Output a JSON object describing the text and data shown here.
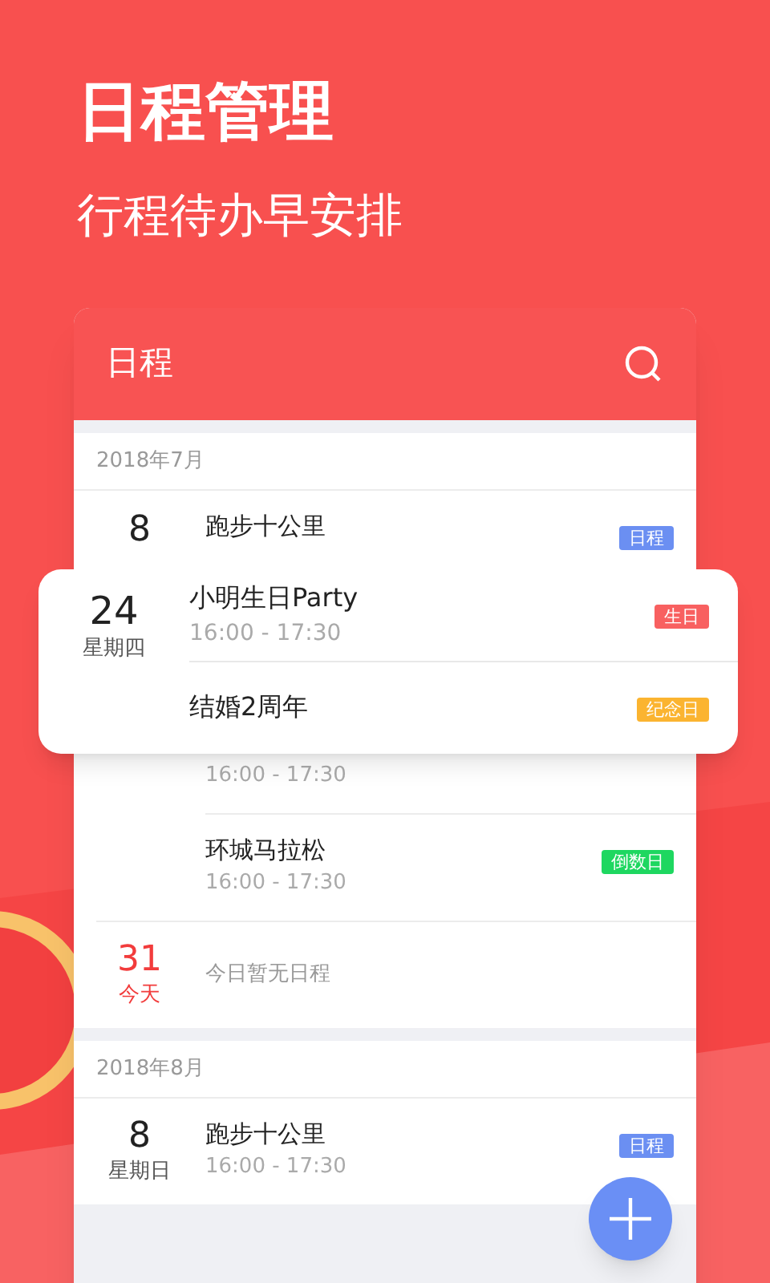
{
  "hero": {
    "title": "日程管理",
    "subtitle": "行程待办早安排"
  },
  "card": {
    "title": "日程"
  },
  "sections": [
    {
      "month": "2018年7月",
      "entries": [
        {
          "day": "8",
          "today": false,
          "title": "跑步十公里",
          "tag": {
            "label": "日程",
            "color": "#6b8ff2"
          }
        },
        {
          "time": "16:00 - 17:30"
        },
        {
          "title": "环城马拉松",
          "time": "16:00 - 17:30",
          "tag": {
            "label": "倒数日",
            "color": "#1ed760"
          }
        },
        {
          "day": "31",
          "weekday": "今天",
          "today": true,
          "note": "今日暂无日程"
        }
      ]
    },
    {
      "month": "2018年8月",
      "entries": [
        {
          "day": "8",
          "weekday": "星期日",
          "today": false,
          "title": "跑步十公里",
          "time": "16:00 - 17:30",
          "tag": {
            "label": "日程",
            "color": "#6b8ff2"
          }
        }
      ]
    }
  ],
  "popup": {
    "day": "24",
    "weekday": "星期四",
    "events": [
      {
        "title": "小明生日Party",
        "time": "16:00 - 17:30",
        "tag": {
          "label": "生日",
          "color": "#f86060"
        }
      },
      {
        "title": "结婚2周年",
        "tag": {
          "label": "纪念日",
          "color": "#fbb430"
        }
      }
    ]
  }
}
